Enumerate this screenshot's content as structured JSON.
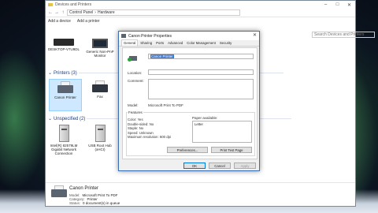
{
  "explorer": {
    "title": "Devices and Printers",
    "path": [
      "Control Panel",
      "Hardware"
    ],
    "search_placeholder": "Search Devices and Printers",
    "commands": [
      "Add a device",
      "Add a printer"
    ],
    "devices_top": [
      {
        "label": "DESKTOP-V7U9DL"
      },
      {
        "label": "Generic Non-PnP Monitor"
      }
    ],
    "printers_header": "Printers (3)",
    "printers": [
      {
        "label": "Canon Printer"
      },
      {
        "label": "Fax"
      }
    ],
    "unspecified_header": "Unspecified (2)",
    "unspecified": [
      {
        "label": "Intel(R) 82579LM Gigabit Network Connection"
      },
      {
        "label": "USB Root Hub (xHCI)"
      }
    ],
    "details": {
      "name": "Canon Printer",
      "model_label": "Model:",
      "model_value": "Microsoft Print To PDF",
      "category_label": "Category:",
      "category_value": "Printer",
      "status_label": "Status:",
      "status_value": "0 document(s) in queue"
    },
    "window_controls": [
      "–",
      "□",
      "✕"
    ]
  },
  "dialog": {
    "title": "Canon Printer Properties",
    "close": "✕",
    "tabs": [
      "General",
      "Sharing",
      "Ports",
      "Advanced",
      "Color Management",
      "Security"
    ],
    "active_tab": "General",
    "printer_name": "Canon Printer",
    "location_label": "Location:",
    "comment_label": "Comment:",
    "model_label": "Model:",
    "model_value": "Microsoft Print To PDF",
    "features_label": "Features",
    "features": [
      "Color: Yes",
      "Double-sided: No",
      "Staple: No",
      "Speed: Unknown",
      "Maximum resolution: 600 dpi"
    ],
    "paper_label": "Paper available:",
    "paper_items": [
      "Letter"
    ],
    "preferences_button": "Preferences...",
    "print_test_button": "Print Test Page",
    "ok_button": "OK",
    "cancel_button": "Cancel",
    "apply_button": "Apply"
  }
}
